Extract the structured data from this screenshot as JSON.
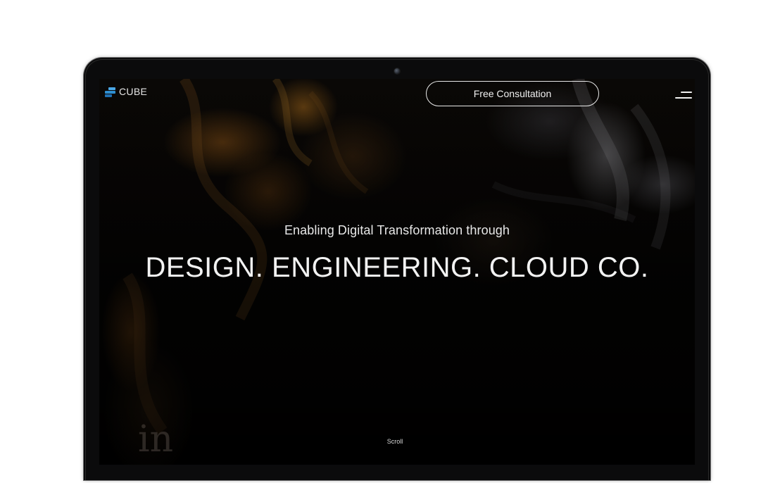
{
  "brand": {
    "name": "CUBE",
    "logo_icon": "stacked-bars-logo",
    "logo_colors": [
      "#2f8fd1",
      "#1f6fb2",
      "#4aa8e6"
    ]
  },
  "header": {
    "cta_label": "Free Consultation",
    "menu_icon": "hamburger-menu-icon"
  },
  "hero": {
    "subtitle": "Enabling Digital Transformation through",
    "title": "DESIGN. ENGINEERING. CLOUD CO."
  },
  "footer": {
    "scroll_label": "Scroll"
  },
  "colors": {
    "page_background": "#ffffff",
    "bezel": "#0b0b0c",
    "text": "#f2f2f2"
  }
}
